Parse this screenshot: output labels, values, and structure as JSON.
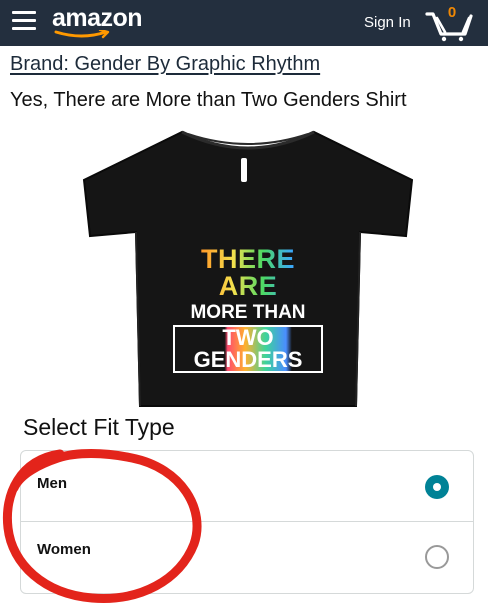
{
  "header": {
    "logo_text": "amazon",
    "signin_label": "Sign In",
    "cart_count": "0",
    "background_color": "#232f3e"
  },
  "product": {
    "brand": "Brand: Gender By Graphic Rhythm",
    "title": "Yes, There are More than Two Genders Shirt",
    "shirt_print": {
      "line1": "THERE ARE",
      "line2": "MORE THAN",
      "line3": "TWO GENDERS"
    },
    "shirt_color": "#151515"
  },
  "fit": {
    "heading": "Select Fit Type",
    "options": [
      {
        "label": "Men",
        "selected": true
      },
      {
        "label": "Women",
        "selected": false
      }
    ],
    "accent_color": "#008296"
  },
  "annotation": {
    "color": "#e3241b",
    "shape": "hand-drawn-circle"
  }
}
